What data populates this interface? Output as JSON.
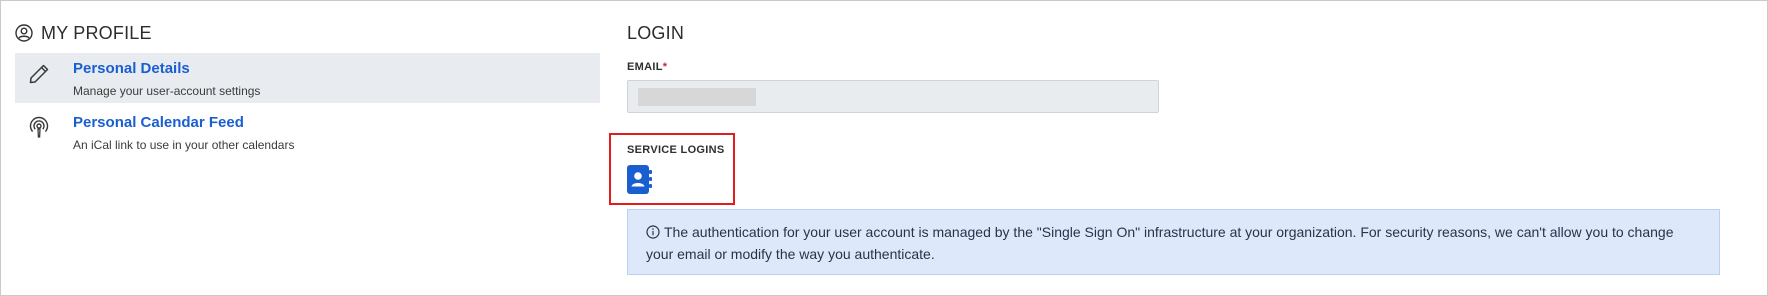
{
  "left": {
    "section_title": "MY PROFILE",
    "profile_icon": "user-circle-icon",
    "nav": [
      {
        "title": "Personal Details",
        "desc": "Manage your user-account settings",
        "icon": "pencil-icon",
        "active": true
      },
      {
        "title": "Personal Calendar Feed",
        "desc": "An iCal link to use in your other calendars",
        "icon": "podcast-feed-icon",
        "active": false
      }
    ]
  },
  "right": {
    "title": "LOGIN",
    "email_label": "EMAIL",
    "email_required_mark": "*",
    "service_logins_label": "SERVICE LOGINS",
    "service_icon": "address-book-icon",
    "info_icon": "info-circle-icon",
    "info_text": "The authentication for your user account is managed by the \"Single Sign On\" infrastructure at your organization. For security reasons, we can't allow you to change your email or modify the way you authenticate."
  },
  "colors": {
    "link_blue": "#1a5fd0",
    "active_bg": "#e8ebef",
    "highlight_red": "#e11e1e",
    "info_bg": "#dde9fb",
    "service_icon_blue": "#1a5fd0"
  }
}
